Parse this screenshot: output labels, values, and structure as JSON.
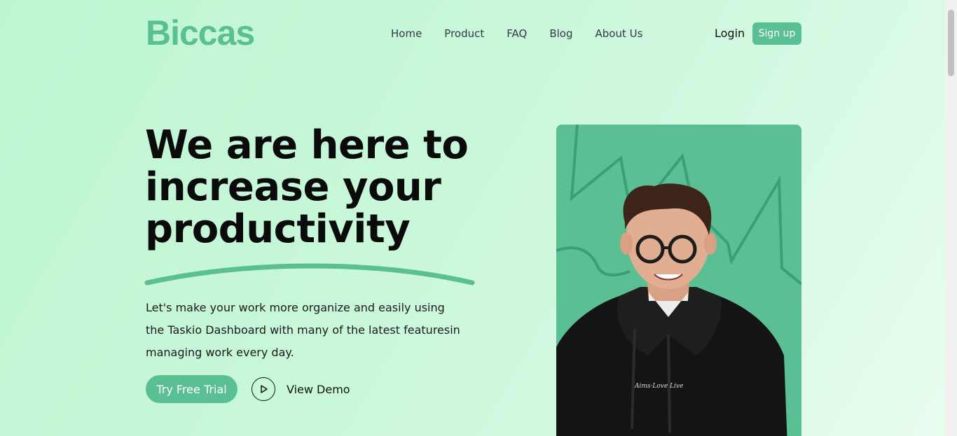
{
  "header": {
    "logo": "Biccas",
    "nav": [
      "Home",
      "Product",
      "FAQ",
      "Blog",
      "About Us"
    ],
    "login": "Login",
    "signup": "Sign up"
  },
  "hero": {
    "headline_lines": [
      "We are here to",
      "increase your",
      "productivity"
    ],
    "description": "Let's make your work more organize and easily using the Taskio Dashboard with many of the latest featuresin managing work every day.",
    "cta_primary": "Try Free Trial",
    "cta_secondary": "View Demo"
  },
  "colors": {
    "accent": "#5bbf94",
    "background": "#c9f7da",
    "text": "#0b0b0b"
  },
  "icons": {
    "play": "play-icon"
  }
}
